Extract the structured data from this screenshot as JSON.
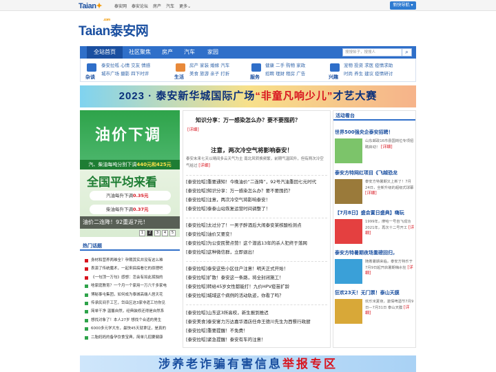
{
  "top": {
    "logo_main": "Taian",
    "nav": [
      "泰安网",
      "泰安论坛",
      "房产",
      "汽车",
      "更多"
    ],
    "btn": "新快导航"
  },
  "logo": {
    "main": "Taian泰安网",
    "com": ".com"
  },
  "nav": {
    "items": [
      "全站首页",
      "社区聚焦",
      "房产",
      "汽车",
      "家园"
    ],
    "search_placeholder": "搜搜帖子，搜搜人"
  },
  "subnav": [
    {
      "label": "杂谈",
      "links": [
        "泰安拉呱 心情 交友 情感",
        "城市广场 摄影 四下时评"
      ]
    },
    {
      "label": "生活",
      "links": [
        "房产 家装 婚嫁 汽车",
        "美食 旅游 亲子 打折"
      ]
    },
    {
      "label": "服务",
      "links": [
        "健康 二手 购物 家政",
        "招聘 理财 租房 广告"
      ]
    },
    {
      "label": "兴趣",
      "links": [
        "宠物 投资 求医 疫情求助",
        "时尚 养生 建议 疫情研讨"
      ]
    }
  ],
  "banner": {
    "pre": "2023 · 泰安新华城国际广场",
    "hl": "“非童凡响少儿”",
    "post": "才艺大赛"
  },
  "lphoto": {
    "t1": "油价下调",
    "t2a": "汽、柴油每吨分别下调",
    "t2b": "440元和425元",
    "t3": "全国平均来看",
    "r1a": "汽油每升下调",
    "r1b": "0.35元",
    "r2a": "柴油每升下调",
    "r2b": "0.37元",
    "caption": "油价二连降！92重返7元！"
  },
  "dots": [
    "1",
    "2",
    "3",
    "4",
    "5"
  ],
  "hot": {
    "title": "热门话题",
    "items": [
      "身材和营养两难全？孕期其实并没有这么难",
      "表演了传统魔术，一起来搞搞看它的原理吧",
      "《一句顶一万句》感想：怎会有如此孤独的",
      "啥家庭教育？一个月一个家用一万六千多家电",
      "博秘事屯集团，如何成为泰城高端人居天花",
      "传承民间手工艺，岱岳区这3家非遗工坊你见",
      "简单干净 温馨自然，经典装修还得是自然系",
      "想找对象了！本人27岁 想找个合适的男生",
      "6000多元学大车，最快45天就拿证，是真的",
      "二胎妈妈的备孕饮食宝典，简单几招要健康"
    ]
  },
  "center": {
    "h1": "知识分享：万一感染怎么办？要不要囤药？",
    "h1_more": "[详细]",
    "h2": "注意，两次冷空气将影响泰安！",
    "h2_desc": "泰安未来七天以晴间多云天气为主 南北风转换频繁，前期气温回升，但有两次冷空气给过",
    "h2_more": "[详细]",
    "g1": [
      "[泰安拉呱]重要通知！今晚油价“二连降”，92号汽油重回七元时代",
      "[泰安拉呱]知识分享：万一感染怎么办？要不要囤药？",
      "[泰安拉呱]注意，两次冷空气将影响泰安！",
      "[泰安拉呱]泰泰山站恢复运营时间调整了！"
    ],
    "g2": [
      "[泰安拉呱]太过分了！一男子醉酒后大闹泰安某核酸检测点",
      "[泰安拉呱]油价又要变！",
      "[泰安拉呱]为公安民警点赞！这个潜逃13年的杀人犯终于落网",
      "[泰安拉呱]这种微信群，立即退出！"
    ],
    "g3": [
      "[泰安拉呱]泰安这些小区住户注意！明天正式开始！",
      "[泰安拉呱]扩散！泰安这一条路，将全封闭施工！",
      "[泰安拉呱]转给45岁女性都能打！九价HPV疫苗扩龄",
      "[泰安拉呱]城域这个病例的活动轨迹，你看了吗？"
    ],
    "g4": [
      "[泰安拉呱]山东这3所高校，新生报到推迟",
      "[泰安美食]泰安宴力万达嘉华酒店任命王德川先生为西餐行政厨",
      "[泰安拉呱]重要提醒！不免费！",
      "[泰安拉呱]紧急提醒！泰安有车的注意！"
    ]
  },
  "right": {
    "title": "活动看台",
    "items": [
      {
        "t": "世界500强央企泰安招聘！",
        "d": "山东邮政16市县国岗位专项招聘启动！",
        "m": "[详细]",
        "c": "#7cc46a"
      },
      {
        "t": "泰安方特网红项目《飞越恐龙",
        "d": "泰安方特暑期又上新了！7月24日，全新升级的超级式球幕",
        "m": "[详细]",
        "c": "#9a7a3a"
      },
      {
        "t": "【7月8日】盛会置日盛典】嗨玩",
        "d": "1999年，摩哈一号自飞成功 2021年，再次十二号开工",
        "m": "[详细]",
        "c": "#e44040"
      },
      {
        "t": "泰安方特暑期夜场重磅回归，",
        "d": "随着暑期来临，泰安方特乐于7月9日起开启暑期嗨水狂",
        "m": "[详细]",
        "c": "#3aa0d8"
      },
      {
        "t": "狂欢23天！无门票！泰山天膜",
        "d": "欢乐米夏夜，激情啤酒节7月9日—7月31日 泰山天膜",
        "m": "[详细]",
        "c": "#d8a838"
      }
    ]
  },
  "bottom": {
    "pre": "涉养老诈骗有害信息",
    "hl": "举报专区"
  }
}
